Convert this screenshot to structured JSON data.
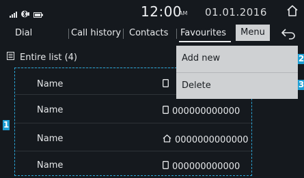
{
  "status": {
    "time": "12:00",
    "ampm": "AM",
    "date": "01.01.2016",
    "icons": [
      "signal-icon",
      "bluetooth-phone-icon",
      "battery-icon"
    ]
  },
  "tabs": [
    {
      "label": "Dial"
    },
    {
      "label": "Call history"
    },
    {
      "label": "Contacts"
    },
    {
      "label": "Favourites",
      "active": true
    }
  ],
  "menu_button": "Menu",
  "list": {
    "header": "Entire list (4)",
    "entries": [
      {
        "name": "Name",
        "number": "",
        "icon": "mobile-phone-icon"
      },
      {
        "name": "Name",
        "number": "000000000000",
        "icon": "mobile-phone-icon"
      },
      {
        "name": "Name",
        "number": "0000000000000",
        "icon": "home-phone-icon"
      },
      {
        "name": "Name",
        "number": "000000000000",
        "icon": "mobile-phone-icon"
      }
    ]
  },
  "dropdown": {
    "items": [
      {
        "label": "Add new"
      },
      {
        "label": "Delete"
      }
    ]
  },
  "callouts": {
    "one": "1",
    "two": "2",
    "three": "3"
  },
  "colors": {
    "accent": "#1f9fd4",
    "background": "#15191e",
    "menu": "#cfd1d3"
  }
}
